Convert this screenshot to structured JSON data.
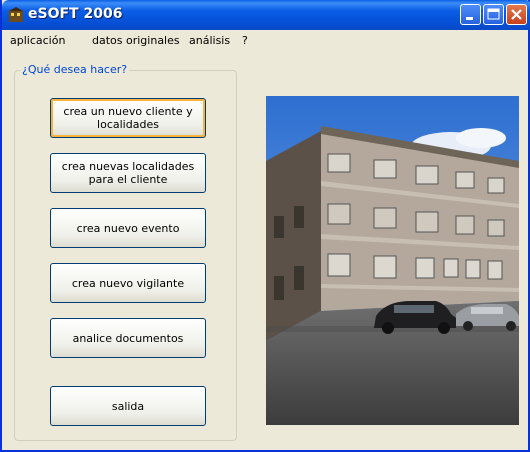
{
  "window": {
    "title": "eSOFT 2006"
  },
  "menu": [
    "aplicación",
    "datos originales",
    "análisis",
    "?"
  ],
  "group": {
    "label": "¿Qué desea hacer?"
  },
  "buttons": [
    "crea un nuevo cliente y localidades",
    "crea nuevas localidades para el cliente",
    "crea nuevo evento",
    "crea nuevo vigilante",
    "analice documentos",
    "salida"
  ],
  "colors": {
    "titlebar": "#0a5fe4",
    "group_label": "#0046d5",
    "background": "#ece9d8"
  }
}
